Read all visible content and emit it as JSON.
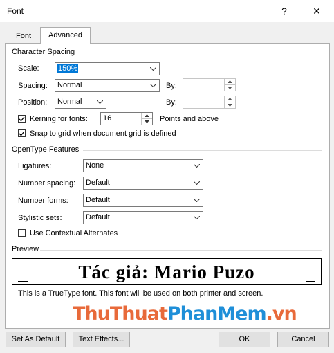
{
  "window": {
    "title": "Font",
    "help": "?",
    "close": "✕"
  },
  "tabs": [
    {
      "label": "Font",
      "hotkey": "n"
    },
    {
      "label": "Advanced",
      "hotkey": "v"
    }
  ],
  "character_spacing": {
    "heading": "Character Spacing",
    "scale": {
      "label": "Scale:",
      "value": "150%"
    },
    "spacing": {
      "label": "Spacing:",
      "value": "Normal",
      "by_label": "By:",
      "by_value": ""
    },
    "position": {
      "label": "Position:",
      "value": "Normal",
      "by_label": "By:",
      "by_value": ""
    },
    "kerning": {
      "label": "Kerning for fonts:",
      "checked": true,
      "value": "16",
      "suffix": "Points and above"
    },
    "snap": {
      "label": "Snap to grid when document grid is defined",
      "checked": true
    }
  },
  "opentype": {
    "heading": "OpenType Features",
    "ligatures": {
      "label": "Ligatures:",
      "value": "None"
    },
    "number_spacing": {
      "label": "Number spacing:",
      "value": "Default"
    },
    "number_forms": {
      "label": "Number forms:",
      "value": "Default"
    },
    "stylistic_sets": {
      "label": "Stylistic sets:",
      "value": "Default"
    },
    "contextual": {
      "label": "Use Contextual Alternates",
      "checked": false
    }
  },
  "preview": {
    "heading": "Preview",
    "text": "Tác giả: Mario Puzo",
    "note": "This is a TrueType font. This font will be used on both printer and screen."
  },
  "watermark": {
    "part1": "ThuThuat",
    "part2": "PhanMem",
    "part3": ".vn"
  },
  "buttons": {
    "set_default": "Set As Default",
    "text_effects": "Text Effects...",
    "ok": "OK",
    "cancel": "Cancel"
  },
  "colors": {
    "accent": "#0078d7",
    "watermark_orange": "#e86a3a",
    "watermark_blue": "#1f8fd8"
  }
}
